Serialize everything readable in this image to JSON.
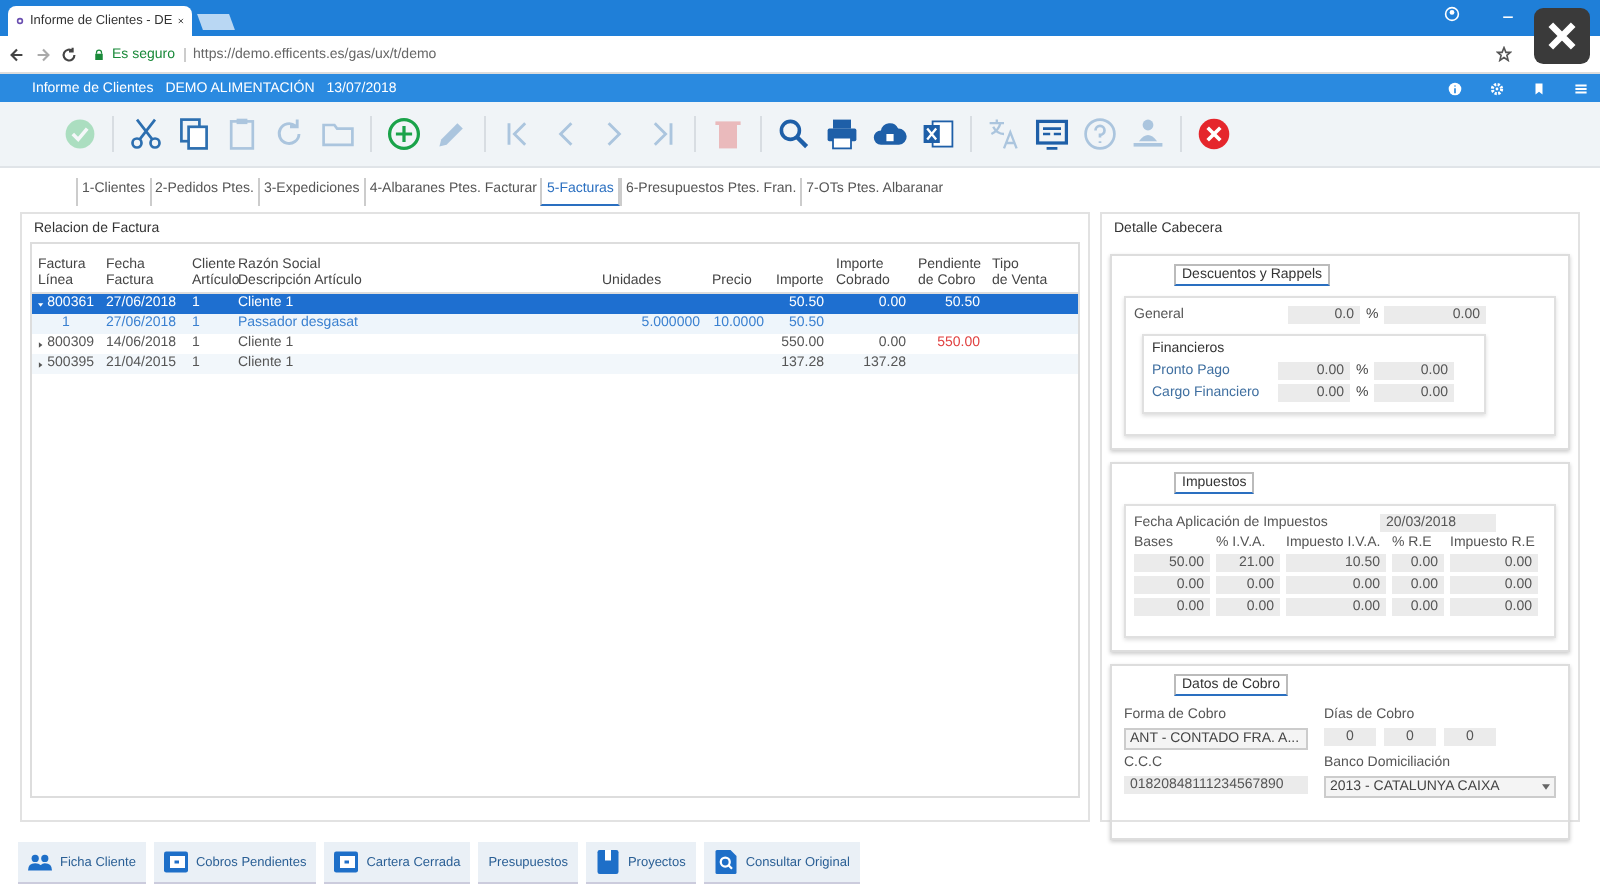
{
  "browser": {
    "tab_title": "Informe de Clientes - DE",
    "secure_label": "Es seguro",
    "url": "https://demo.efficents.es/gas/ux/t/demo"
  },
  "app_header": {
    "title": "Informe de Clientes",
    "company": "DEMO ALIMENTACIÓN",
    "date": "13/07/2018"
  },
  "toolbar_groups": [
    {
      "items": [
        {
          "kind": "check",
          "disabled": true
        }
      ]
    },
    {
      "items": [
        {
          "kind": "cut",
          "disabled": false
        },
        {
          "kind": "copy",
          "disabled": false
        },
        {
          "kind": "paste",
          "disabled": true
        },
        {
          "kind": "redo",
          "disabled": true
        },
        {
          "kind": "folder",
          "disabled": true
        }
      ]
    },
    {
      "items": [
        {
          "kind": "add",
          "disabled": false
        },
        {
          "kind": "edit",
          "disabled": true
        }
      ]
    },
    {
      "items": [
        {
          "kind": "first",
          "disabled": true
        },
        {
          "kind": "prev",
          "disabled": true
        },
        {
          "kind": "next",
          "disabled": true
        },
        {
          "kind": "last",
          "disabled": true
        }
      ]
    },
    {
      "items": [
        {
          "kind": "delete",
          "disabled": true
        }
      ]
    },
    {
      "items": [
        {
          "kind": "search",
          "disabled": false
        },
        {
          "kind": "print",
          "disabled": false
        },
        {
          "kind": "cloud",
          "disabled": false
        },
        {
          "kind": "excel",
          "disabled": false
        }
      ]
    },
    {
      "items": [
        {
          "kind": "translate",
          "disabled": true
        },
        {
          "kind": "screen",
          "disabled": false
        },
        {
          "kind": "help",
          "disabled": true
        },
        {
          "kind": "person",
          "disabled": true
        }
      ]
    },
    {
      "items": [
        {
          "kind": "close",
          "disabled": false
        }
      ]
    }
  ],
  "tabs": [
    {
      "label": "1-Clientes",
      "selected": false
    },
    {
      "label": "2-Pedidos Ptes.",
      "selected": false
    },
    {
      "label": "3-Expediciones",
      "selected": false
    },
    {
      "label": "4-Albaranes Ptes. Facturar",
      "selected": false
    },
    {
      "label": "5-Facturas",
      "selected": true
    },
    {
      "label": "6-Presupuestos Ptes. Fran.",
      "selected": false
    },
    {
      "label": "7-OTs Ptes. Albaranar",
      "selected": false
    }
  ],
  "invoices": {
    "title": "Relacion de Factura",
    "columns": [
      {
        "lines": [
          "Factura",
          "Línea"
        ]
      },
      {
        "lines": [
          "Fecha",
          "Factura"
        ]
      },
      {
        "lines": [
          "Cliente",
          "Artículo"
        ]
      },
      {
        "lines": [
          "Razón Social",
          "Descripción Artículo"
        ]
      },
      {
        "lines": [
          "Unidades"
        ]
      },
      {
        "lines": [
          "Precio"
        ]
      },
      {
        "lines": [
          "Importe"
        ]
      },
      {
        "lines": [
          "Importe",
          "Cobrado"
        ]
      },
      {
        "lines": [
          "Pendiente",
          "de Cobro"
        ]
      },
      {
        "lines": [
          "Tipo",
          "de Venta"
        ]
      }
    ],
    "rows": [
      {
        "id": "800361",
        "date": "27/06/2018",
        "client": "1",
        "name": "Cliente 1",
        "amount": "50.50",
        "paid": "0.00",
        "pending": "50.50",
        "selected": true,
        "expanded": true,
        "children": [
          {
            "id": "1",
            "date": "27/06/2018",
            "client": "1",
            "name": "Passador desgasat",
            "units": "5.000000",
            "price": "10.0000",
            "amount": "50.50"
          }
        ]
      },
      {
        "id": "800309",
        "date": "14/06/2018",
        "client": "1",
        "name": "Cliente 1",
        "amount": "550.00",
        "paid": "0.00",
        "pending": "550.00",
        "alert": true,
        "selected": false,
        "expanded": false
      },
      {
        "id": "500395",
        "date": "21/04/2015",
        "client": "1",
        "name": "Cliente 1",
        "amount": "137.28",
        "paid": "137.28",
        "selected": false,
        "expanded": false
      }
    ]
  },
  "detail": {
    "title": "Detalle Cabecera",
    "discounts": {
      "tab": "Descuentos y Rappels",
      "general": {
        "label": "General",
        "percent": "0.0",
        "percent_sign": "%",
        "amount": "0.00"
      },
      "financial_title": "Financieros",
      "rows": [
        {
          "label": "Pronto Pago",
          "percent": "0.00",
          "percent_sign": "%",
          "amount": "0.00"
        },
        {
          "label": "Cargo Financiero",
          "percent": "0.00",
          "percent_sign": "%",
          "amount": "0.00"
        }
      ]
    },
    "taxes": {
      "tab": "Impuestos",
      "date_label": "Fecha Aplicación de Impuestos",
      "date": "20/03/2018",
      "headers": [
        "Bases",
        "% I.V.A.",
        "Impuesto I.V.A.",
        "% R.E",
        "Impuesto R.E"
      ],
      "rows": [
        [
          "50.00",
          "21.00",
          "10.50",
          "0.00",
          "0.00"
        ],
        [
          "0.00",
          "0.00",
          "0.00",
          "0.00",
          "0.00"
        ],
        [
          "0.00",
          "0.00",
          "0.00",
          "0.00",
          "0.00"
        ]
      ]
    },
    "payment": {
      "tab": "Datos de Cobro",
      "method_label": "Forma de Cobro",
      "method": "ANT - CONTADO FRA. A...",
      "days_label": "Días de Cobro",
      "days": [
        "0",
        "0",
        "0"
      ],
      "ccc_label": "C.C.C",
      "ccc": "01820848111234567890",
      "bank_label": "Banco Domiciliación",
      "bank": "2013 - CATALUNYA CAIXA"
    }
  },
  "bottom_buttons": [
    {
      "kind": "people",
      "label": "Ficha Cliente"
    },
    {
      "kind": "wallet",
      "label": "Cobros Pendientes"
    },
    {
      "kind": "wallet",
      "label": "Cartera Cerrada"
    },
    {
      "kind": "none",
      "label": "Presupuestos"
    },
    {
      "kind": "binder",
      "label": "Proyectos"
    },
    {
      "kind": "doc-search",
      "label": "Consultar Original"
    }
  ]
}
